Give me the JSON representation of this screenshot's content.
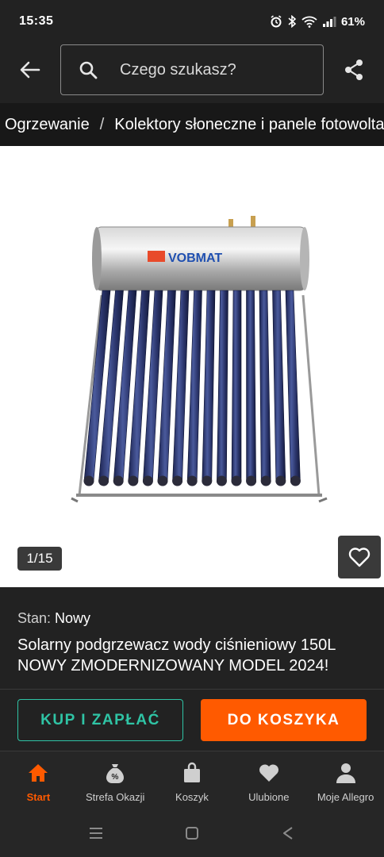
{
  "status_bar": {
    "time": "15:35",
    "battery": "61%"
  },
  "header": {
    "search_placeholder": "Czego szukasz?"
  },
  "breadcrumb": {
    "items": [
      "Ogrzewanie",
      "Kolektory słoneczne i panele fotowoltaiczne"
    ],
    "separator": "/"
  },
  "gallery": {
    "counter": "1/15",
    "brand_on_tank": "VOBMAT"
  },
  "product": {
    "condition_label": "Stan:",
    "condition_value": "Nowy",
    "title": "Solarny podgrzewacz wody ciśnieniowy 150L NOWY ZMODERNIZOWANY MODEL 2024!"
  },
  "actions": {
    "buy_now": "KUP I ZAPŁAĆ",
    "add_to_cart": "DO KOSZYKA"
  },
  "bottom_nav": {
    "items": [
      {
        "label": "Start",
        "icon": "home-icon",
        "active": true
      },
      {
        "label": "Strefa Okazji",
        "icon": "deals-bag-icon",
        "active": false
      },
      {
        "label": "Koszyk",
        "icon": "cart-bag-icon",
        "active": false
      },
      {
        "label": "Ulubione",
        "icon": "heart-icon",
        "active": false
      },
      {
        "label": "Moje Allegro",
        "icon": "user-icon",
        "active": false
      }
    ]
  },
  "colors": {
    "accent": "#ff5a00",
    "teal": "#2fc4a5",
    "background": "#222222"
  }
}
